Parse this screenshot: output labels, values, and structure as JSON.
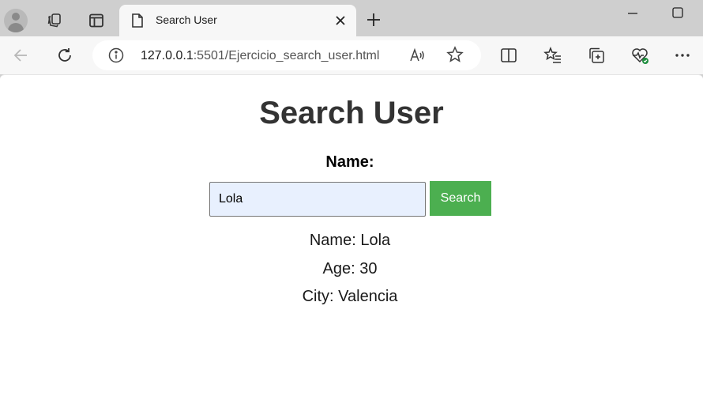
{
  "browser": {
    "tab": {
      "title": "Search User"
    },
    "address": {
      "host": "127.0.0.1",
      "path": ":5501/Ejercicio_search_user.html"
    }
  },
  "page": {
    "heading": "Search User",
    "name_label": "Name:",
    "search": {
      "value": "Lola",
      "placeholder": ""
    },
    "search_button": "Search",
    "result": {
      "name": "Name: Lola",
      "age": "Age: 30",
      "city": "City: Valencia"
    }
  },
  "colors": {
    "button_bg": "#4caf50",
    "input_autofill_bg": "#e8f0fe",
    "heading_text": "#333333"
  },
  "icons": [
    "profile-avatar-icon",
    "workspaces-icon",
    "vertical-tabs-icon",
    "document-icon",
    "close-icon",
    "plus-icon",
    "minimize-icon",
    "maximize-icon",
    "back-arrow-icon",
    "refresh-icon",
    "info-icon",
    "read-aloud-icon",
    "star-icon",
    "split-screen-icon",
    "favorites-icon",
    "collections-icon",
    "browser-essentials-icon",
    "more-icon"
  ]
}
